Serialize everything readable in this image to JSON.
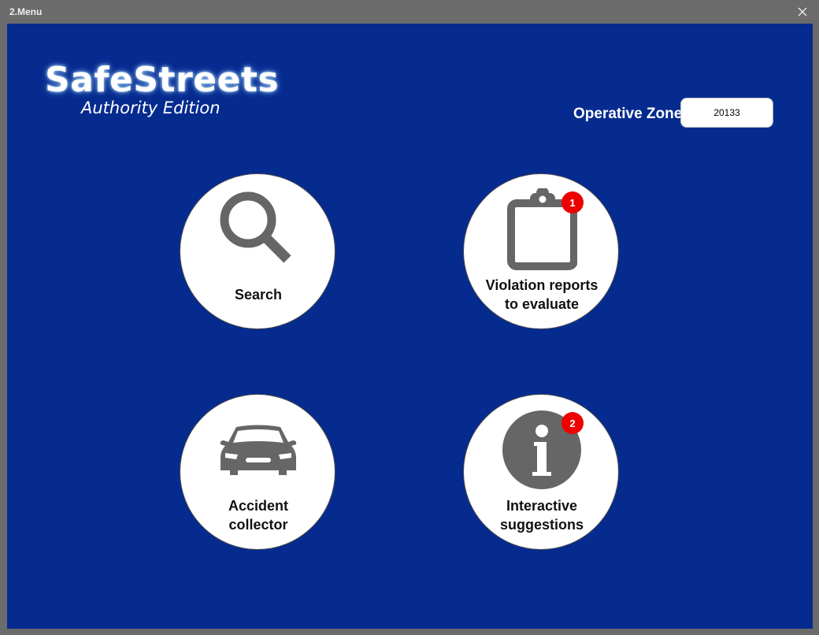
{
  "window": {
    "title": "2.Menu",
    "close_icon": "close-icon"
  },
  "logo": {
    "name": "SafeStreets",
    "subtitle": "Authority Edition"
  },
  "operative_zone": {
    "label": "Operative Zone",
    "value": "20133"
  },
  "menu": {
    "search": {
      "label": "Search",
      "icon": "search-icon"
    },
    "violations": {
      "label_line1": "Violation reports",
      "label_line2": "to evaluate",
      "icon": "clipboard-icon",
      "badge": "1"
    },
    "accidents": {
      "label_line1": "Accident",
      "label_line2": "collector",
      "icon": "car-icon"
    },
    "suggestions": {
      "label_line1": "Interactive",
      "label_line2": "suggestions",
      "icon": "info-icon",
      "badge": "2"
    }
  },
  "colors": {
    "background": "#062b8f",
    "frame": "#6b6b6b",
    "icon": "#666666",
    "badge": "#ee0000",
    "button": "#ffffff"
  }
}
